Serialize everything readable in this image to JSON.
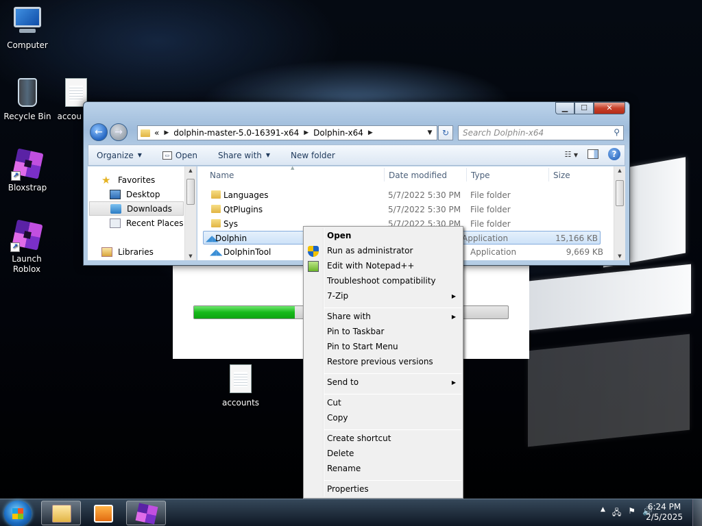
{
  "desktop": {
    "icons": [
      {
        "label": "Computer",
        "icon": "computer-icon"
      },
      {
        "label": "Recycle Bin",
        "icon": "recycle-bin-icon"
      },
      {
        "label": "accou Co",
        "icon": "text-document-icon"
      },
      {
        "label": "Bloxstrap",
        "icon": "bloxstrap-icon"
      },
      {
        "label": "Launch Roblox",
        "icon": "roblox-icon"
      },
      {
        "label": "accounts",
        "icon": "text-document-icon"
      }
    ]
  },
  "installer": {
    "progress": 0.32,
    "progress_color": "#17b91a"
  },
  "explorer": {
    "address": {
      "prefix": "«",
      "segments": [
        "dolphin-master-5.0-16391-x64",
        "Dolphin-x64"
      ]
    },
    "search_placeholder": "Search Dolphin-x64",
    "toolbar": {
      "organize": "Organize",
      "open": "Open",
      "share_with": "Share with",
      "new_folder": "New folder"
    },
    "nav": {
      "favorites": "Favorites",
      "desktop": "Desktop",
      "downloads": "Downloads",
      "recent": "Recent Places",
      "libraries": "Libraries"
    },
    "columns": {
      "name": "Name",
      "date": "Date modified",
      "type": "Type",
      "size": "Size"
    },
    "files": [
      {
        "name": "Languages",
        "date": "5/7/2022 5:30 PM",
        "type": "File folder",
        "size": ""
      },
      {
        "name": "QtPlugins",
        "date": "5/7/2022 5:30 PM",
        "type": "File folder",
        "size": ""
      },
      {
        "name": "Sys",
        "date": "5/7/2022 5:30 PM",
        "type": "File folder",
        "size": ""
      },
      {
        "name": "Dolphin",
        "date": "",
        "type": "Application",
        "size": "15,166 KB"
      },
      {
        "name": "DolphinTool",
        "date": "",
        "type": "Application",
        "size": "9,669 KB"
      }
    ]
  },
  "context_menu": {
    "items": {
      "open": "Open",
      "run_admin": "Run as administrator",
      "edit_npp": "Edit with Notepad++",
      "troubleshoot": "Troubleshoot compatibility",
      "zip": "7-Zip",
      "share_with": "Share with",
      "pin_taskbar": "Pin to Taskbar",
      "pin_start": "Pin to Start Menu",
      "restore": "Restore previous versions",
      "send_to": "Send to",
      "cut": "Cut",
      "copy": "Copy",
      "create_shortcut": "Create shortcut",
      "delete": "Delete",
      "rename": "Rename",
      "properties": "Properties"
    }
  },
  "taskbar": {
    "time": "6:24 PM",
    "date": "2/5/2025"
  },
  "colors": {
    "selection": "#cde2f8",
    "accent": "#1a59b5"
  }
}
